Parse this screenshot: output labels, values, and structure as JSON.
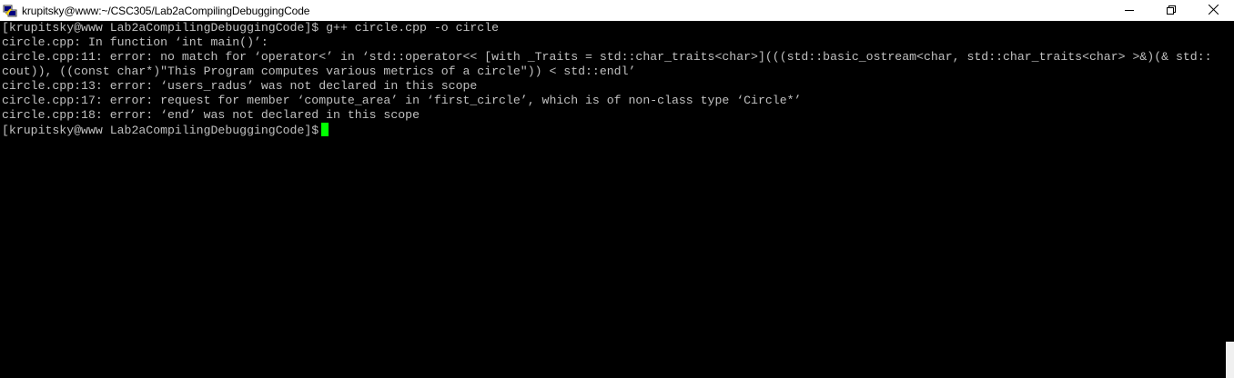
{
  "window": {
    "title": "krupitsky@www:~/CSC305/Lab2aCompilingDebuggingCode",
    "app_icon": "putty-terminal-icon",
    "controls": {
      "minimize_icon": "minimize-icon",
      "maximize_icon": "restore-icon",
      "close_icon": "close-icon"
    }
  },
  "terminal": {
    "lines": [
      "[krupitsky@www Lab2aCompilingDebuggingCode]$ g++ circle.cpp -o circle",
      "circle.cpp: In function ‘int main()’:",
      "circle.cpp:11: error: no match for ‘operator<’ in ‘std::operator<< [with _Traits = std::char_traits<char>](((std::basic_ostream<char, std::char_traits<char> >&)(& std::",
      "cout)), ((const char*)\"This Program computes various metrics of a circle\")) < std::endl’",
      "circle.cpp:13: error: ‘users_radus’ was not declared in this scope",
      "circle.cpp:17: error: request for member ‘compute_area’ in ‘first_circle’, which is of non-class type ‘Circle*’",
      "circle.cpp:18: error: ‘end’ was not declared in this scope"
    ],
    "prompt": "[krupitsky@www Lab2aCompilingDebuggingCode]$",
    "cursor_color": "#00ff00",
    "text_color": "#c0c0c0",
    "background_color": "#000000"
  }
}
